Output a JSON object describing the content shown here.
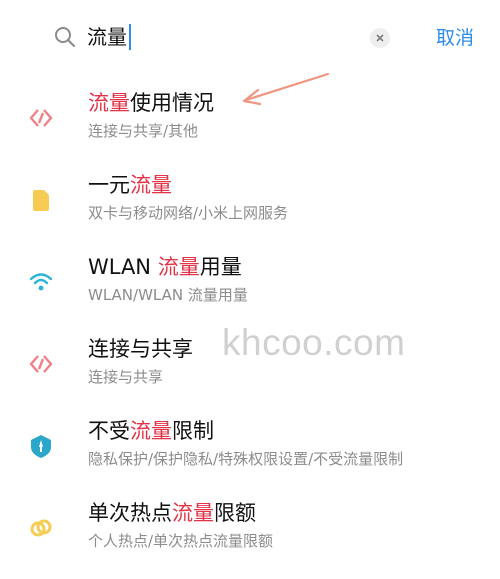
{
  "search": {
    "query": "流量",
    "cancel_label": "取消"
  },
  "results": [
    {
      "title_parts": [
        "",
        "流量",
        "使用情况"
      ],
      "subtitle": "连接与共享/其他",
      "icon": "connection-share-icon",
      "icon_color": "#f07f86"
    },
    {
      "title_parts": [
        "一元",
        "流量",
        ""
      ],
      "subtitle": "双卡与移动网络/小米上网服务",
      "icon": "sim-card-icon",
      "icon_color": "#f7cc55"
    },
    {
      "title_parts": [
        "WLAN ",
        "流量",
        "用量"
      ],
      "subtitle": "WLAN/WLAN 流量用量",
      "icon": "wifi-icon",
      "icon_color": "#2ab4d8"
    },
    {
      "title_parts": [
        "连接与共享",
        "",
        ""
      ],
      "subtitle": "连接与共享",
      "icon": "connection-share-icon",
      "icon_color": "#f07f86"
    },
    {
      "title_parts": [
        "不受",
        "流量",
        "限制"
      ],
      "subtitle": "隐私保护/保护隐私/特殊权限设置/不受流量限制",
      "icon": "shield-icon",
      "icon_color": "#2aa7c9"
    },
    {
      "title_parts": [
        "单次热点",
        "流量",
        "限额"
      ],
      "subtitle": "个人热点/单次热点流量限额",
      "icon": "hotspot-icon",
      "icon_color": "#f7cc55"
    }
  ],
  "watermark": "khcoo.com",
  "colors": {
    "highlight": "#e33346",
    "accent": "#2c8cf0",
    "arrow": "#f0957f"
  }
}
